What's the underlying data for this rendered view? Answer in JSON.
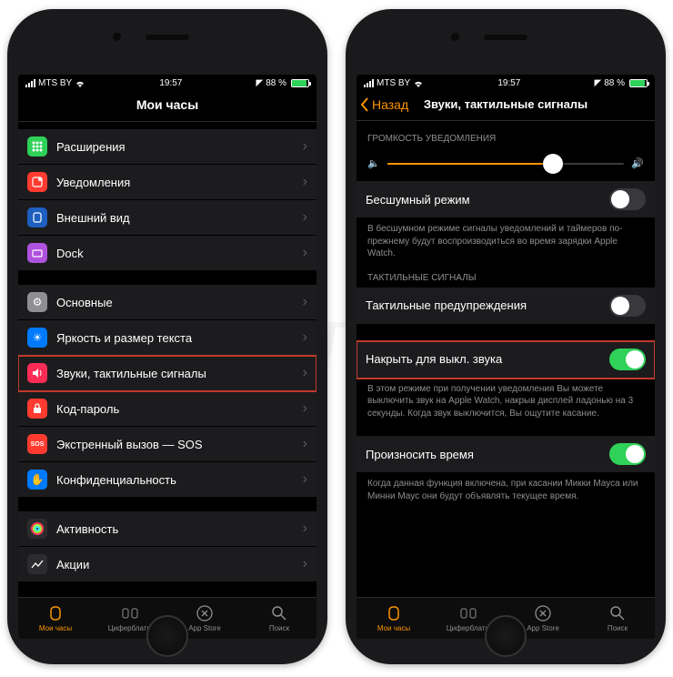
{
  "status": {
    "carrier": "MTS BY",
    "time": "19:57",
    "battery_pct": "88 %",
    "battery_fill_pct": 88
  },
  "left_phone": {
    "title": "Мои часы",
    "group1": [
      {
        "label": "Расширения",
        "icon": "grid",
        "bg": "bg-green"
      },
      {
        "label": "Уведомления",
        "icon": "bell",
        "bg": "bg-red"
      },
      {
        "label": "Внешний вид",
        "icon": "face",
        "bg": "bg-blue"
      },
      {
        "label": "Dock",
        "icon": "dock",
        "bg": "bg-purple"
      }
    ],
    "group2": [
      {
        "label": "Основные",
        "icon": "gear",
        "bg": "bg-gray"
      },
      {
        "label": "Яркость и размер текста",
        "icon": "brightness",
        "bg": "bg-blue"
      },
      {
        "label": "Звуки, тактильные сигналы",
        "icon": "speaker",
        "bg": "bg-pink",
        "highlight": true
      },
      {
        "label": "Код-пароль",
        "icon": "lock",
        "bg": "bg-red"
      },
      {
        "label": "Экстренный вызов — SOS",
        "icon": "sos",
        "bg": "bg-red"
      },
      {
        "label": "Конфиденциальность",
        "icon": "hand",
        "bg": "bg-blue"
      }
    ],
    "group3": [
      {
        "label": "Активность",
        "icon": "rings",
        "bg": "bg-black"
      },
      {
        "label": "Акции",
        "icon": "stocks",
        "bg": "bg-black"
      }
    ]
  },
  "right_phone": {
    "back": "Назад",
    "title": "Звуки, тактильные сигналы",
    "volume_header": "ГРОМКОСТЬ УВЕДОМЛЕНИЯ",
    "slider_pct": 70,
    "silent_label": "Бесшумный режим",
    "silent_footer": "В бесшумном режиме сигналы уведомлений и таймеров по-прежнему будут воспроизводиться во время зарядки Apple Watch.",
    "haptic_header": "ТАКТИЛЬНЫЕ СИГНАЛЫ",
    "haptic_label": "Тактильные предупреждения",
    "cover_label": "Накрыть для выкл. звука",
    "cover_footer": "В этом режиме при получении уведомления Вы можете выключить звук на Apple Watch, накрыв дисплей ладонью на 3 секунды. Когда звук выключится, Вы ощутите касание.",
    "speak_label": "Произносить время",
    "speak_footer": "Когда данная функция включена, при касании Микки Мауса или Минни Маус они будут объявлять текущее время."
  },
  "tabs": {
    "t1": "Мои часы",
    "t2": "Циферблаты",
    "t3": "App Store",
    "t4": "Поиск"
  }
}
